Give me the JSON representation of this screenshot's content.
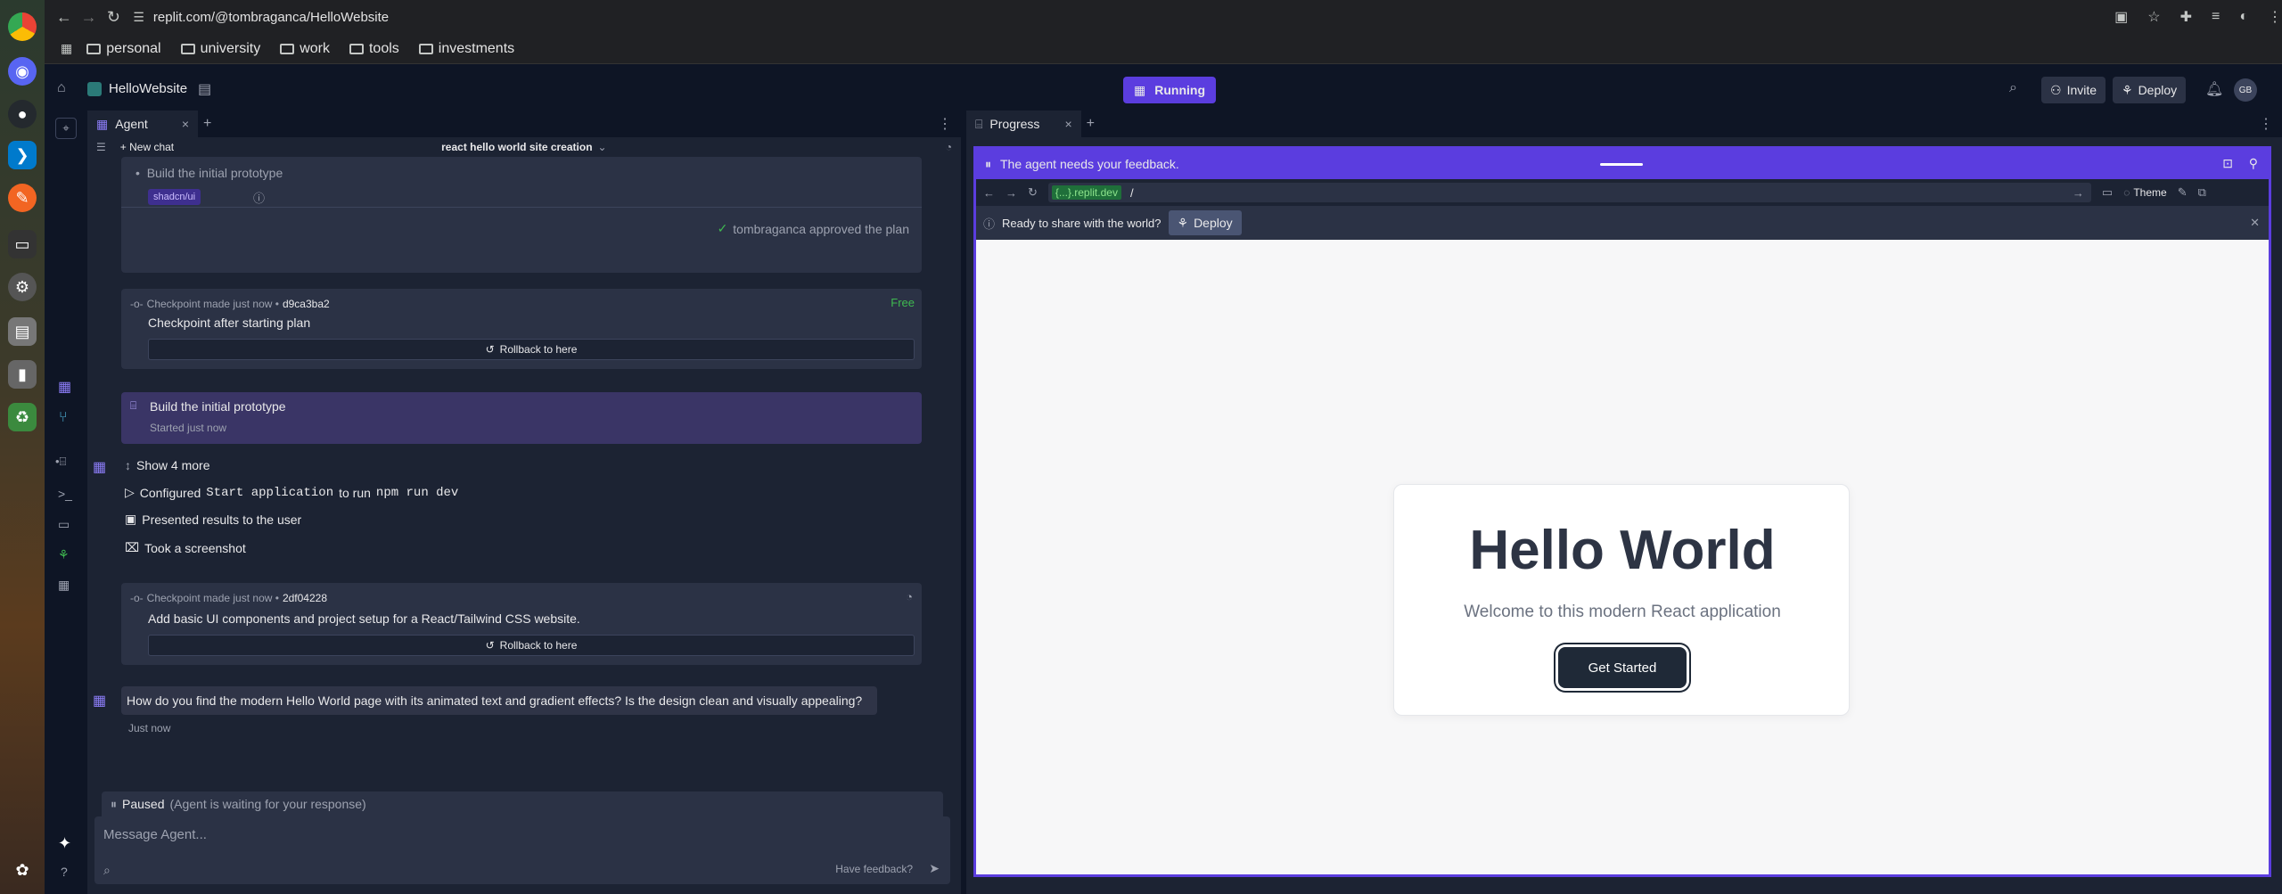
{
  "browser": {
    "url": "replit.com/@tombraganca/HelloWebsite",
    "bookmarks": [
      "personal",
      "university",
      "work",
      "tools",
      "investments"
    ]
  },
  "replit": {
    "project": "HelloWebsite",
    "status": "Running",
    "invite": "Invite",
    "deploy": "Deploy",
    "avatar": "GB"
  },
  "agent": {
    "tab": "Agent",
    "new_chat": "New chat",
    "chat_title": "react hello world site creation",
    "plan_item": "Build the initial prototype",
    "tag": "shadcn/ui",
    "approved": "tombraganca approved the plan",
    "checkpoint1": {
      "meta": "Checkpoint made just now •",
      "hash": "d9ca3ba2",
      "free": "Free",
      "title": "Checkpoint after starting plan",
      "rollback": "Rollback to here"
    },
    "task": {
      "title": "Build the initial prototype",
      "sub": "Started just now"
    },
    "show_more": "Show 4 more",
    "actions": {
      "configured": "Configured",
      "cmd1": "Start application",
      "to_run": "to run",
      "cmd2": "npm run dev",
      "presented": "Presented results to the user",
      "screenshot": "Took a screenshot"
    },
    "checkpoint2": {
      "meta": "Checkpoint made just now •",
      "hash": "2df04228",
      "title": "Add basic UI components and project setup for a React/Tailwind CSS website.",
      "rollback": "Rollback to here"
    },
    "question": "How do you find the modern Hello World page with its animated text and gradient effects? Is the design clean and visually appealing?",
    "question_time": "Just now",
    "paused": "Paused",
    "paused_note": "(Agent is waiting for your response)",
    "input_placeholder": "Message Agent...",
    "feedback": "Have feedback?"
  },
  "progress": {
    "tab": "Progress",
    "banner": "The agent needs your feedback.",
    "preview_url_tag": "{...}.replit.dev",
    "preview_path": "/",
    "theme": "Theme",
    "share_text": "Ready to share with the world?",
    "share_deploy": "Deploy"
  },
  "site": {
    "heading": "Hello World",
    "subtitle": "Welcome to this modern React application",
    "cta": "Get Started"
  }
}
